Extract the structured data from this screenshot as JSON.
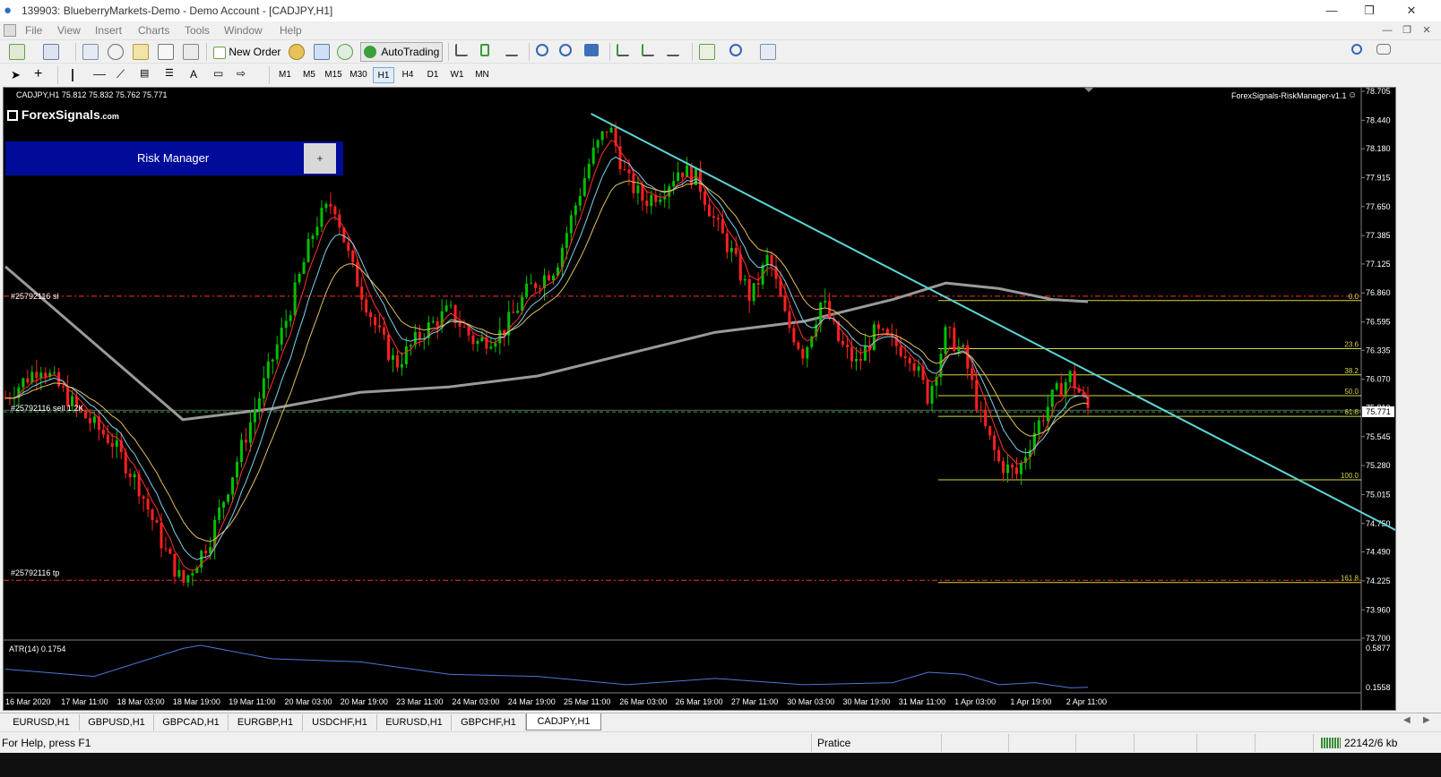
{
  "window": {
    "title": "139903: BlueberryMarkets-Demo - Demo Account - [CADJPY,H1]"
  },
  "menu": {
    "items": [
      "File",
      "View",
      "Insert",
      "Charts",
      "Tools",
      "Window",
      "Help"
    ]
  },
  "toolbar": {
    "new_order_label": "New Order",
    "autotrading_label": "AutoTrading",
    "timeframes": [
      "M1",
      "M5",
      "M15",
      "M30",
      "H1",
      "H4",
      "D1",
      "W1",
      "MN"
    ],
    "active_timeframe": "H1"
  },
  "chart": {
    "header": "CADJPY,H1  75.812 75.832 75.762 75.771",
    "logo_text": "ForexSignals",
    "logo_suffix": ".com",
    "ea_label": "ForexSignals-RiskManager-v1.1",
    "risk_manager": {
      "label": "Risk Manager",
      "plus_label": "+"
    },
    "order_labels": {
      "sl": "#25792116 sl",
      "sell": "#25792116 sell 1.2K",
      "tp": "#25792116 tp"
    },
    "current_price": "75.771",
    "indicator_label": "ATR(14) 0.1754",
    "indicator_axis": [
      "0.5877",
      "0.1558"
    ]
  },
  "chart_data": {
    "type": "candlestick",
    "symbol": "CADJPY",
    "timeframe": "H1",
    "y_ticks": [
      78.705,
      78.44,
      78.18,
      77.915,
      77.65,
      77.385,
      77.125,
      76.86,
      76.595,
      76.335,
      76.07,
      75.81,
      75.545,
      75.28,
      75.015,
      74.75,
      74.49,
      74.225,
      73.96,
      73.7
    ],
    "y_tick_labels": [
      "78.705",
      "78.440",
      "78.180",
      "77.915",
      "77.650",
      "77.385",
      "77.125",
      "76.860",
      "76.595",
      "76.335",
      "76.070",
      "75.810",
      "75.545",
      "75.280",
      "75.015",
      "74.750",
      "74.490",
      "74.225",
      "73.960",
      "73.700"
    ],
    "ylim": [
      73.7,
      78.705
    ],
    "x_tick_labels": [
      "16 Mar 2020",
      "17 Mar 11:00",
      "18 Mar 03:00",
      "18 Mar 19:00",
      "19 Mar 11:00",
      "20 Mar 03:00",
      "20 Mar 19:00",
      "23 Mar 11:00",
      "24 Mar 03:00",
      "24 Mar 19:00",
      "25 Mar 11:00",
      "26 Mar 03:00",
      "26 Mar 19:00",
      "27 Mar 11:00",
      "30 Mar 03:00",
      "30 Mar 19:00",
      "31 Mar 11:00",
      "1 Apr 03:00",
      "1 Apr 19:00",
      "2 Apr 11:00"
    ],
    "price_path": [
      [
        0,
        75.9
      ],
      [
        4,
        76.2
      ],
      [
        8,
        75.8
      ],
      [
        12,
        75.5
      ],
      [
        15,
        75.1
      ],
      [
        18,
        74.5
      ],
      [
        20,
        74.2
      ],
      [
        23,
        74.6
      ],
      [
        26,
        75.3
      ],
      [
        29,
        76.0
      ],
      [
        32,
        76.7
      ],
      [
        35,
        77.5
      ],
      [
        37,
        77.7
      ],
      [
        39,
        77.1
      ],
      [
        42,
        76.5
      ],
      [
        44,
        76.2
      ],
      [
        47,
        76.5
      ],
      [
        50,
        76.7
      ],
      [
        53,
        76.4
      ],
      [
        56,
        76.5
      ],
      [
        59,
        76.9
      ],
      [
        62,
        77.1
      ],
      [
        64,
        77.6
      ],
      [
        66,
        78.1
      ],
      [
        68,
        78.4
      ],
      [
        70,
        77.9
      ],
      [
        72,
        77.7
      ],
      [
        74,
        77.8
      ],
      [
        76,
        78.0
      ],
      [
        78,
        77.9
      ],
      [
        80,
        77.5
      ],
      [
        82,
        77.2
      ],
      [
        84,
        76.8
      ],
      [
        86,
        77.2
      ],
      [
        88,
        76.6
      ],
      [
        90,
        76.3
      ],
      [
        92,
        76.8
      ],
      [
        94,
        76.4
      ],
      [
        96,
        76.2
      ],
      [
        98,
        76.5
      ],
      [
        100,
        76.4
      ],
      [
        102,
        76.3
      ],
      [
        104,
        75.9
      ],
      [
        106,
        76.5
      ],
      [
        108,
        76.3
      ],
      [
        110,
        75.7
      ],
      [
        112,
        75.3
      ],
      [
        114,
        75.2
      ],
      [
        116,
        75.6
      ],
      [
        118,
        75.9
      ],
      [
        120,
        76.1
      ],
      [
        122,
        75.8
      ]
    ],
    "ma_slow_path": [
      [
        0,
        77.1
      ],
      [
        10,
        76.4
      ],
      [
        20,
        75.7
      ],
      [
        30,
        75.8
      ],
      [
        40,
        75.95
      ],
      [
        50,
        76.0
      ],
      [
        60,
        76.1
      ],
      [
        70,
        76.3
      ],
      [
        80,
        76.5
      ],
      [
        90,
        76.6
      ],
      [
        100,
        76.8
      ],
      [
        106,
        76.95
      ],
      [
        112,
        76.9
      ],
      [
        118,
        76.8
      ],
      [
        122,
        76.78
      ]
    ],
    "trendline": {
      "from": [
        66,
        78.5
      ],
      "to": [
        160,
        74.55
      ]
    },
    "fibonacci": {
      "levels": [
        {
          "label": "0.0",
          "price": 76.79
        },
        {
          "label": "23.6",
          "price": 76.35
        },
        {
          "label": "38.2",
          "price": 76.11
        },
        {
          "label": "50.0",
          "price": 75.92
        },
        {
          "label": "61.8",
          "price": 75.73
        },
        {
          "label": "100.0",
          "price": 75.15
        },
        {
          "label": "161.8",
          "price": 74.21
        }
      ]
    },
    "horizontal_lines": {
      "sl": 76.83,
      "sell": 75.771,
      "tp": 74.23
    },
    "atr_path": [
      [
        0,
        0.35
      ],
      [
        10,
        0.28
      ],
      [
        20,
        0.55
      ],
      [
        22,
        0.58
      ],
      [
        30,
        0.45
      ],
      [
        40,
        0.42
      ],
      [
        50,
        0.3
      ],
      [
        60,
        0.28
      ],
      [
        70,
        0.2
      ],
      [
        80,
        0.26
      ],
      [
        90,
        0.2
      ],
      [
        100,
        0.22
      ],
      [
        104,
        0.32
      ],
      [
        108,
        0.3
      ],
      [
        112,
        0.2
      ],
      [
        116,
        0.22
      ],
      [
        120,
        0.17
      ],
      [
        122,
        0.1754
      ]
    ]
  },
  "tabs": [
    "EURUSD,H1",
    "GBPUSD,H1",
    "GBPCAD,H1",
    "EURGBP,H1",
    "USDCHF,H1",
    "EURUSD,H1",
    "GBPCHF,H1",
    "CADJPY,H1"
  ],
  "active_tab": "CADJPY,H1",
  "status": {
    "help": "For Help, press F1",
    "profile": "Pratice",
    "traffic": "22142/6 kb"
  },
  "colors": {
    "bull": "#00c000",
    "bear": "#ff2020",
    "trendline": "#5cd6d6",
    "fib": "#d8d840",
    "order_line": "#ff3030",
    "ma_slow": "#9a9a9a",
    "atr": "#4a78d8",
    "risk_bg": "#000b99"
  }
}
